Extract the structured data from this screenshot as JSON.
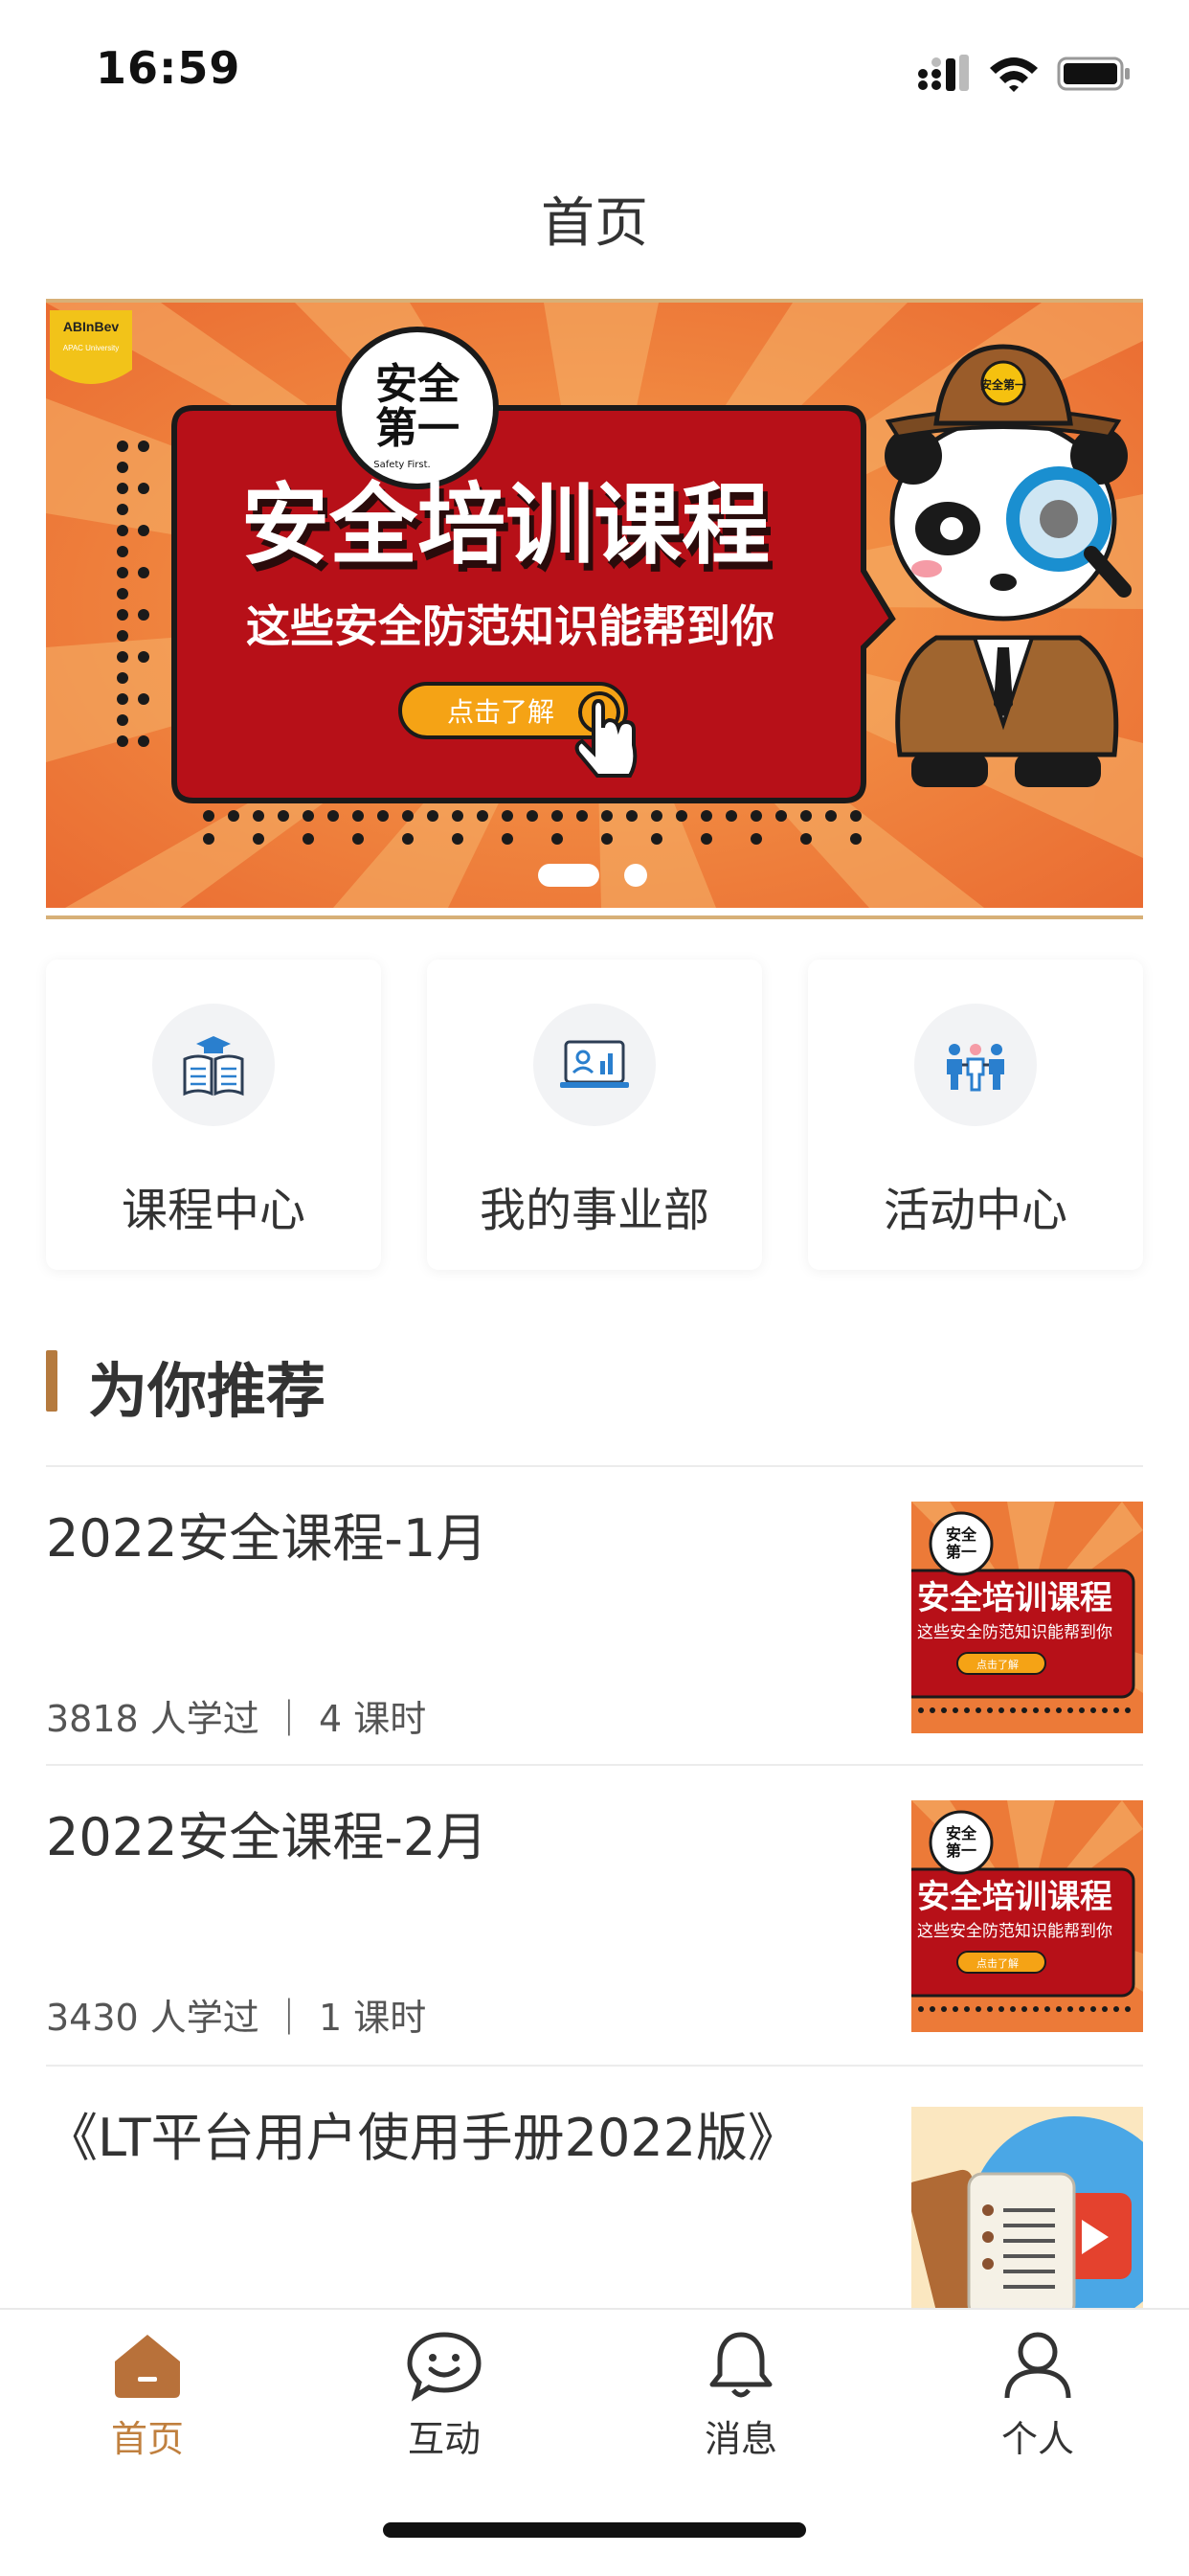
{
  "status_bar": {
    "time": "16:59"
  },
  "header": {
    "title": "首页"
  },
  "banner": {
    "brand": "ABInBev",
    "brand_sub": "APAC University",
    "badge_line1": "安全",
    "badge_line2": "第一",
    "badge_caption": "Safety First.",
    "headline": "安全培训课程",
    "subheadline": "这些安全防范知识能帮到你",
    "cta_label": "点击了解",
    "hat_badge": "安全第一",
    "page_count": 2,
    "active_page": 1
  },
  "menu": [
    {
      "label": "课程中心",
      "icon": "book-icon"
    },
    {
      "label": "我的事业部",
      "icon": "monitor-chart-icon"
    },
    {
      "label": "活动中心",
      "icon": "people-icon"
    }
  ],
  "section": {
    "title": "为你推荐"
  },
  "recommendations": [
    {
      "title": "2022安全课程-1月",
      "meta": "3818 人学过 ｜ 4 课时"
    },
    {
      "title": "2022安全课程-2月",
      "meta": "3430 人学过 ｜ 1 课时"
    },
    {
      "title": "《LT平台用户使用手册2022版》",
      "meta": ""
    }
  ],
  "thumb": {
    "badge_line1": "安全",
    "badge_line2": "第一",
    "headline": "安全培训课程",
    "subheadline": "这些安全防范知识能帮到你",
    "cta_label": "点击了解"
  },
  "tabbar": {
    "items": [
      {
        "label": "首页",
        "icon": "home-icon",
        "active": true
      },
      {
        "label": "互动",
        "icon": "chat-icon",
        "active": false
      },
      {
        "label": "消息",
        "icon": "bell-icon",
        "active": false
      },
      {
        "label": "个人",
        "icon": "person-icon",
        "active": false
      }
    ],
    "active_color": "#c0803f"
  }
}
